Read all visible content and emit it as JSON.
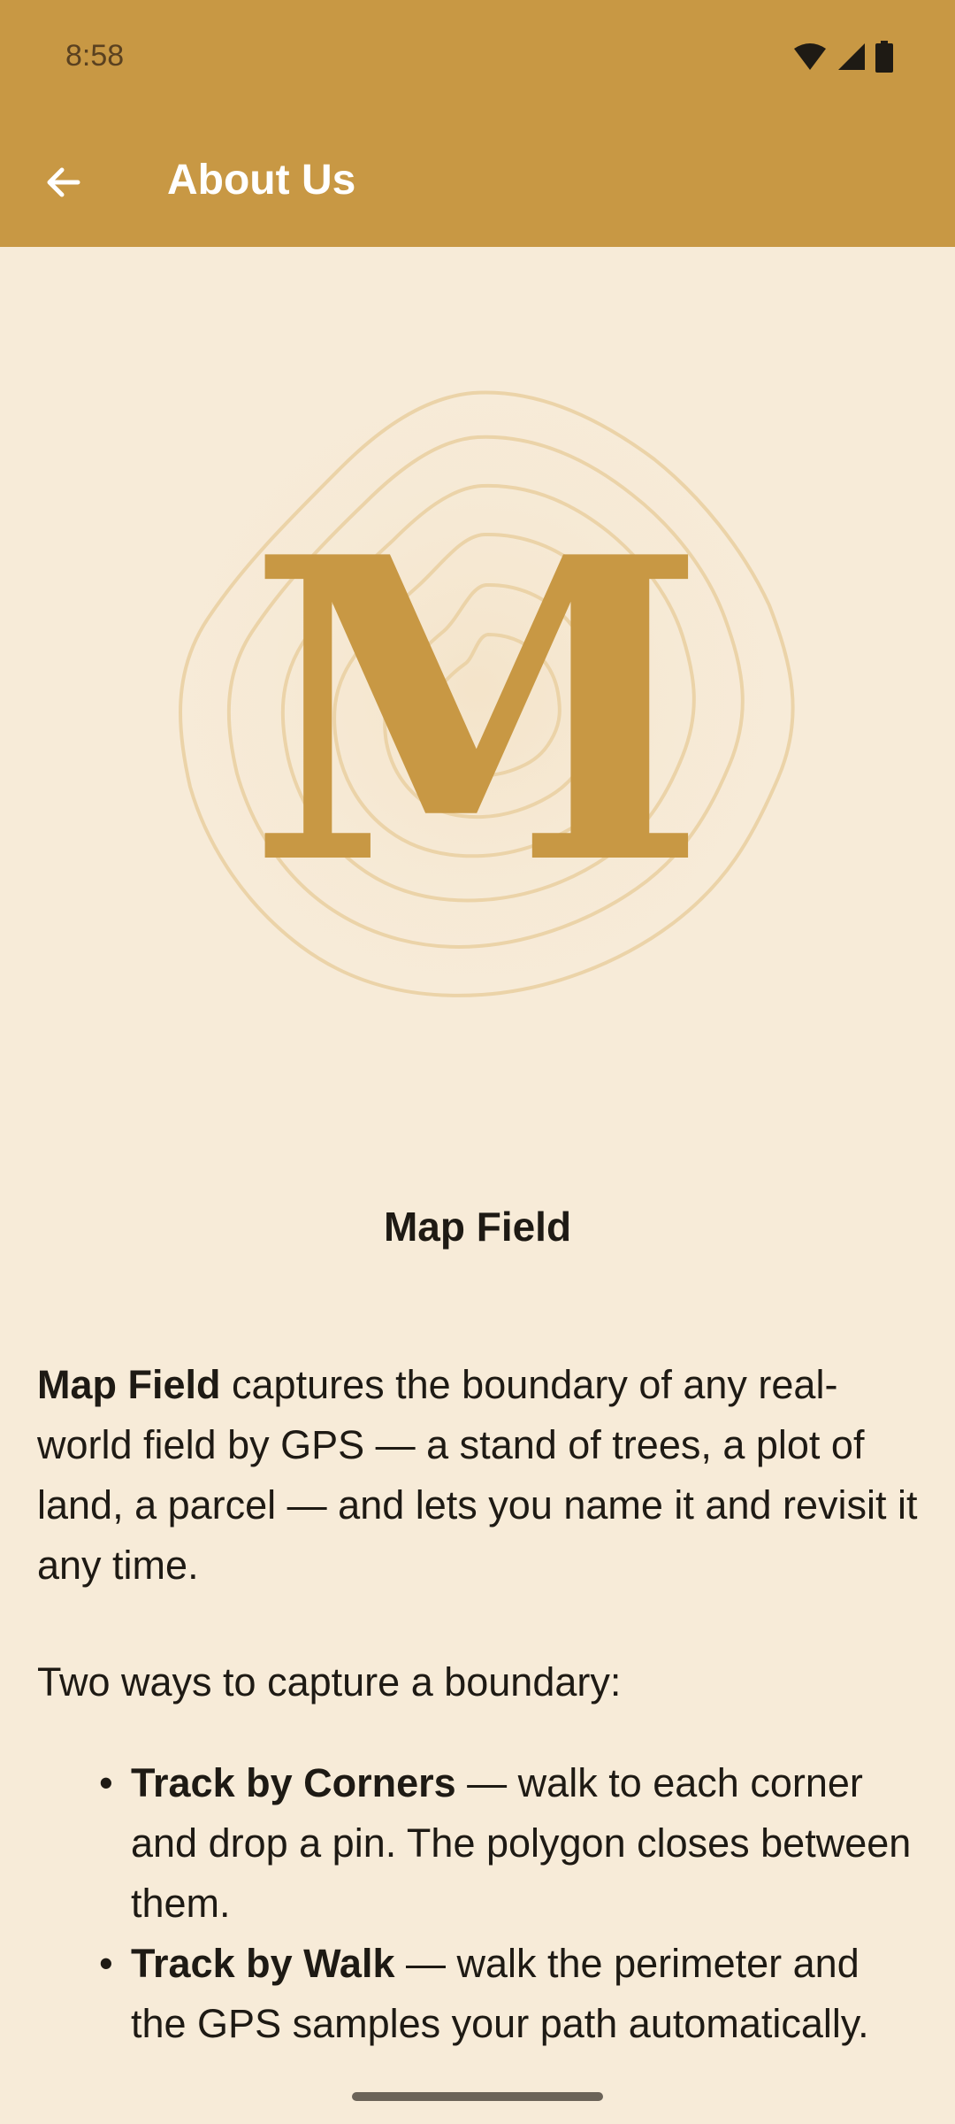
{
  "status_bar": {
    "time": "8:58",
    "icons": [
      "wifi-icon",
      "signal-icon",
      "battery-icon"
    ]
  },
  "app_bar": {
    "back_icon": "arrow-left-icon",
    "title": "About Us"
  },
  "logo": {
    "letter": "M"
  },
  "app_name": "Map Field",
  "intro": {
    "bold": "Map Field",
    "text": " captures the boundary of any real-world field by GPS — a stand of trees, a plot of land, a parcel — and lets you name it and revisit it any time."
  },
  "ways_heading": "Two ways to capture a boundary:",
  "bullets": [
    {
      "bold": "Track by Corners",
      "text": " — walk to each corner and drop a pin. The polygon closes between them."
    },
    {
      "bold": "Track by Walk",
      "text": " — walk the perimeter and the GPS samples your path automatically."
    }
  ],
  "colors": {
    "primary": "#C89844",
    "background": "#F7EBD8",
    "contour": "#EBD3A8",
    "text": "#1E1A14"
  }
}
